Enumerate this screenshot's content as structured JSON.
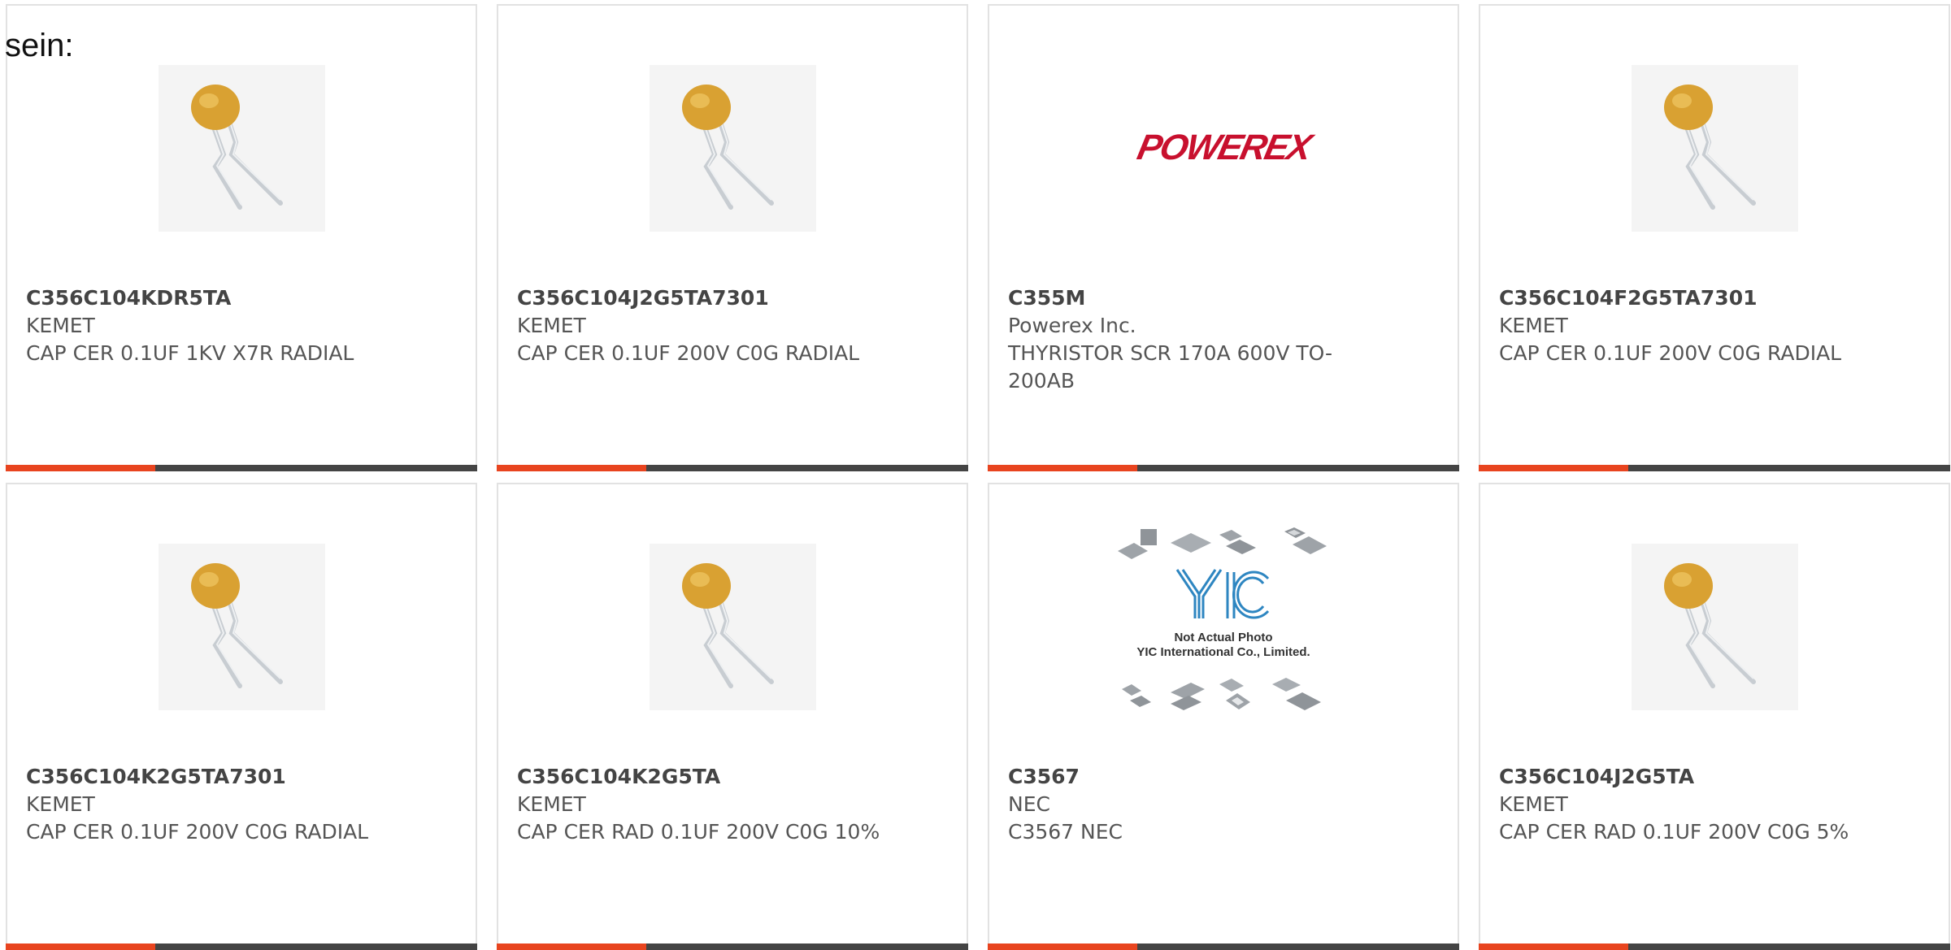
{
  "header": {
    "label": "sein:"
  },
  "colors": {
    "accent": "#e8441f",
    "bar": "#444444",
    "border": "#e2e2e2"
  },
  "products": [
    {
      "part": "C356C104KDR5TA",
      "manufacturer": "KEMET",
      "description": "CAP CER 0.1UF 1KV X7R RADIAL",
      "image": "ceramic-capacitor-photo"
    },
    {
      "part": "C356C104J2G5TA7301",
      "manufacturer": "KEMET",
      "description": "CAP CER 0.1UF 200V C0G RADIAL",
      "image": "ceramic-capacitor-photo"
    },
    {
      "part": "C355M",
      "manufacturer": "Powerex Inc.",
      "description": "THYRISTOR SCR 170A 600V TO-200AB",
      "image": "powerex-logo",
      "logo_text": "POWEREX"
    },
    {
      "part": "C356C104F2G5TA7301",
      "manufacturer": "KEMET",
      "description": "CAP CER 0.1UF 200V C0G RADIAL",
      "image": "ceramic-capacitor-photo"
    },
    {
      "part": "C356C104K2G5TA7301",
      "manufacturer": "KEMET",
      "description": "CAP CER 0.1UF 200V C0G RADIAL",
      "image": "ceramic-capacitor-photo"
    },
    {
      "part": "C356C104K2G5TA",
      "manufacturer": "KEMET",
      "description": "CAP CER RAD 0.1UF 200V C0G 10%",
      "image": "ceramic-capacitor-photo"
    },
    {
      "part": "C3567",
      "manufacturer": "NEC",
      "description": "C3567 NEC",
      "image": "yic-placeholder-photo",
      "placeholder_line1": "Not Actual Photo",
      "placeholder_line2": "YIC International Co., Limited."
    },
    {
      "part": "C356C104J2G5TA",
      "manufacturer": "KEMET",
      "description": "CAP CER RAD 0.1UF 200V C0G 5%",
      "image": "ceramic-capacitor-photo"
    }
  ]
}
